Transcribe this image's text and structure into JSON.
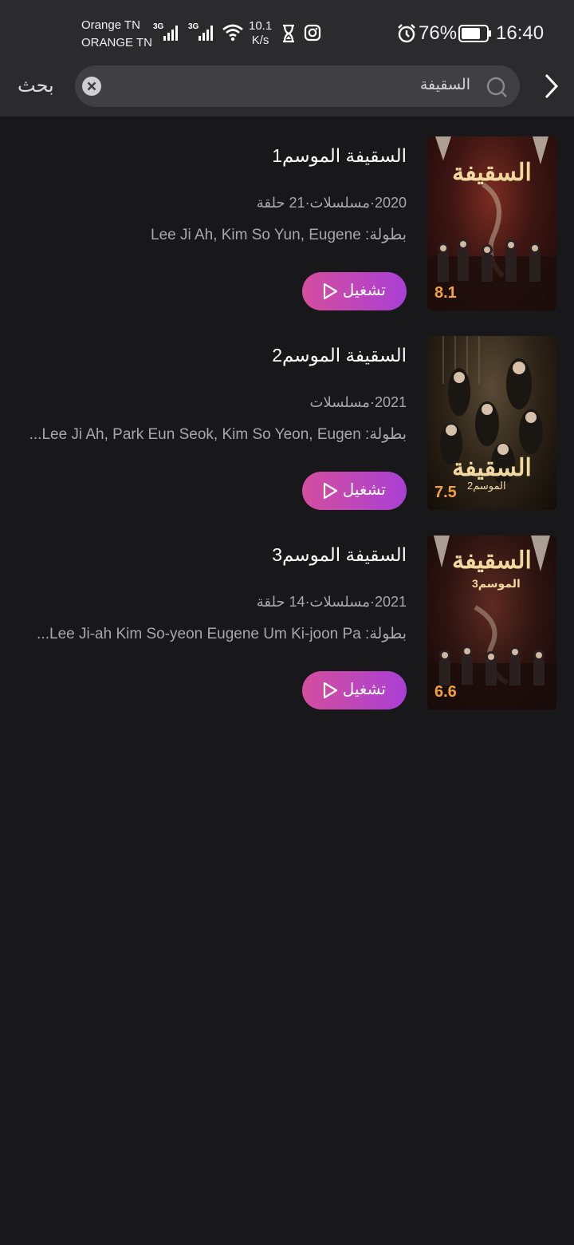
{
  "status_bar": {
    "carrier_1": "Orange TN",
    "carrier_2": "ORANGE TN",
    "network_1": "3G",
    "network_2": "3G",
    "speed_value": "10.1",
    "speed_unit": "K/s",
    "battery": "76%",
    "time": "16:40",
    "icons": [
      "signal-icon",
      "wifi-icon",
      "hourglass-icon",
      "instagram-icon",
      "alarm-icon",
      "battery-icon"
    ]
  },
  "search": {
    "query": "السقيفة",
    "action_label": "بحث",
    "icons": [
      "chevron-right-icon",
      "search-icon",
      "clear-icon"
    ]
  },
  "results": [
    {
      "title": "السقيفة الموسم1",
      "meta": "2020·مسلسلات·21 حلقة",
      "cast": "بطولة: Lee Ji Ah, Kim So Yun, Eugene",
      "rating": "8.1",
      "poster_title": "السقيفة",
      "poster_subtitle": "",
      "play_label": "تشغيل"
    },
    {
      "title": "السقيفة الموسم2",
      "meta": "2021·مسلسلات",
      "cast": "بطولة: Lee Ji Ah, Park Eun Seok, Kim So Yeon, Eugen...",
      "rating": "7.5",
      "poster_title": "السقيفة",
      "poster_subtitle": "الموسم2",
      "play_label": "تشغيل"
    },
    {
      "title": "السقيفة الموسم3",
      "meta": "2021·مسلسلات·14 حلقة",
      "cast": "بطولة: Lee Ji-ah Kim So-yeon Eugene Um Ki-joon Pa...",
      "rating": "6.6",
      "poster_title": "السقيفة",
      "poster_subtitle": "الموسم3",
      "play_label": "تشغيل"
    }
  ],
  "colors": {
    "background": "#18181b",
    "header": "#2b2b2d",
    "rating": "#f3a23a",
    "play_gradient_start": "#d44e9e",
    "play_gradient_end": "#a93fd4"
  }
}
